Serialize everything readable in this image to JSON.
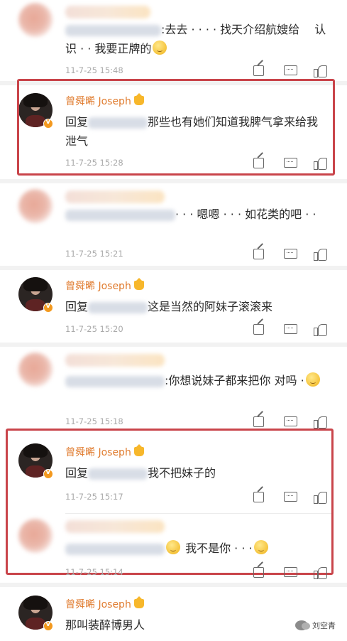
{
  "comments": [
    {
      "text": ":去去 · · · · 找天介绍航嫂给　 认识 · · 我要正牌的",
      "time": "11-7-25 15:48"
    },
    {
      "name": "曾舜晞 Joseph",
      "reply_prefix": "回复",
      "text": "那些也有她们知道我脾气拿来给我泄气",
      "time": "11-7-25 15:28"
    },
    {
      "text": "· · · 嗯嗯 · · · 如花类的吧 · ·",
      "time": "11-7-25 15:21"
    },
    {
      "name": "曾舜晞 Joseph",
      "reply_prefix": "回复",
      "text": "这是当然的阿妹子滚滚来",
      "time": "11-7-25 15:20"
    },
    {
      "text": ":你想说妹子都来把你 对吗 ·",
      "time": "11-7-25 15:18"
    },
    {
      "name": "曾舜晞 Joseph",
      "reply_prefix": "回复",
      "text": "我不把妹子的",
      "time": "11-7-25 15:17"
    },
    {
      "text": "我不是你 · · ·",
      "time": "11-7-25 15:14"
    },
    {
      "name": "曾舜晞 Joseph",
      "text": "那叫装醉博男人"
    }
  ],
  "watermark": "刘空青",
  "highlight_color": "#c9444a",
  "name_color": "#e07b2e",
  "icons": {
    "share": "share-icon",
    "comment": "comment-icon",
    "like": "like-icon",
    "verified": "verified-badge-icon",
    "crown": "crown-icon"
  }
}
